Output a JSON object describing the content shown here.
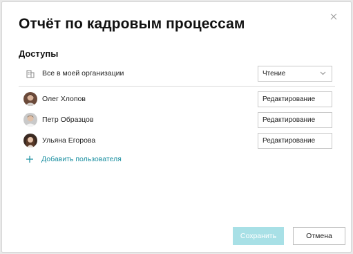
{
  "dialog": {
    "title": "Отчёт по кадровым процессам",
    "close_icon": "close-icon"
  },
  "access": {
    "heading": "Доступы",
    "organization": {
      "icon": "building-icon",
      "label": "Все в моей организации",
      "permission": "Чтение",
      "chevron_icon": "chevron-down-icon"
    },
    "users": [
      {
        "name": "Олег Хлопов",
        "permission": "Редактирование",
        "avatar": "avatar-photo"
      },
      {
        "name": "Петр Образцов",
        "permission": "Редактирование",
        "avatar": "avatar-photo"
      },
      {
        "name": "Ульяна Егорова",
        "permission": "Редактирование",
        "avatar": "avatar-photo"
      }
    ],
    "add_user": {
      "icon": "plus-icon",
      "label": "Добавить пользователя"
    }
  },
  "footer": {
    "save_label": "Сохранить",
    "cancel_label": "Отмена"
  },
  "colors": {
    "accent": "#1a8fa0",
    "save_disabled_bg": "#a8e0e6"
  }
}
